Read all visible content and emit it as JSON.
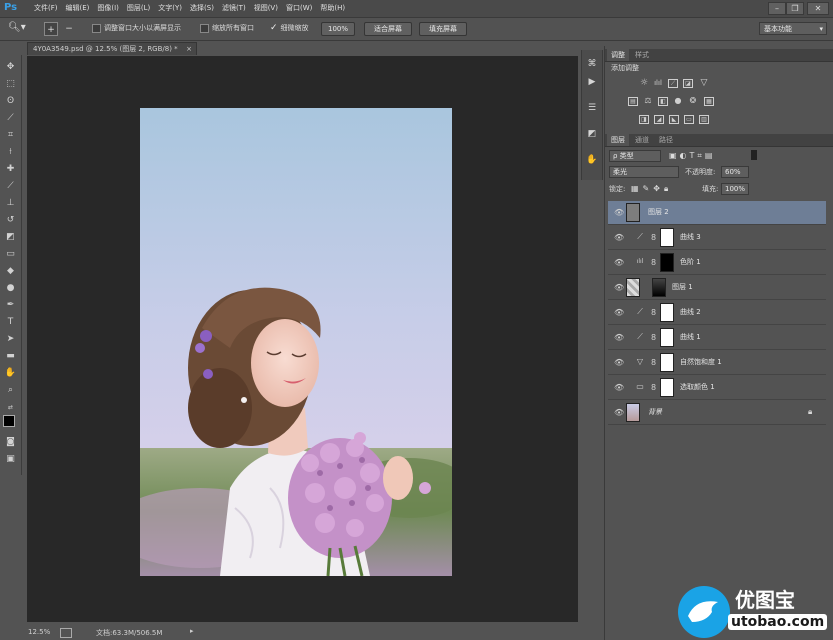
{
  "app": {
    "logo": "Ps"
  },
  "menu": [
    "文件(F)",
    "编辑(E)",
    "图像(I)",
    "图层(L)",
    "文字(Y)",
    "选择(S)",
    "滤镜(T)",
    "视图(V)",
    "窗口(W)",
    "帮助(H)"
  ],
  "window_controls": [
    "minimize-icon",
    "restore-icon",
    "close-icon"
  ],
  "options_bar": {
    "resize_windows": "调整窗口大小以满屏显示",
    "zoom_all_windows": "缩放所有窗口",
    "scrubby_zoom": "细微缩放",
    "zoom_value": "100%",
    "fit_screen": "适合屏幕",
    "fill_screen": "填充屏幕",
    "workspace": "基本功能"
  },
  "document": {
    "tab_title": "4Y0A3549.psd @ 12.5% (图层 2, RGB/8) *",
    "zoom": "12.5%",
    "doc_size": "文档:63.3M/506.5M"
  },
  "adjustments_panel": {
    "tabs": [
      "调整",
      "样式"
    ],
    "title": "添加调整"
  },
  "layers_panel": {
    "tabs": [
      "图层",
      "通道",
      "路径"
    ],
    "filter_kind": "ρ 类型",
    "blend_mode": "柔光",
    "opacity_label": "不透明度:",
    "opacity_value": "60%",
    "lock_label": "锁定:",
    "fill_label": "填充:",
    "fill_value": "100%",
    "layers": [
      {
        "name": "图层 2",
        "type": "pixel-gray",
        "selected": true
      },
      {
        "name": "曲线 3",
        "type": "curves",
        "mask": "white"
      },
      {
        "name": "色阶 1",
        "type": "levels",
        "mask": "black"
      },
      {
        "name": "图层 1",
        "type": "pixel-gradient"
      },
      {
        "name": "曲线 2",
        "type": "curves",
        "mask": "white"
      },
      {
        "name": "曲线 1",
        "type": "curves",
        "mask": "white"
      },
      {
        "name": "自然饱和度 1",
        "type": "vibrance",
        "mask": "white"
      },
      {
        "name": "选取颜色 1",
        "type": "selective-color",
        "mask": "white"
      },
      {
        "name": "背景",
        "type": "background"
      }
    ]
  },
  "watermark": {
    "brand": "优图宝",
    "url": "utobao.com"
  }
}
